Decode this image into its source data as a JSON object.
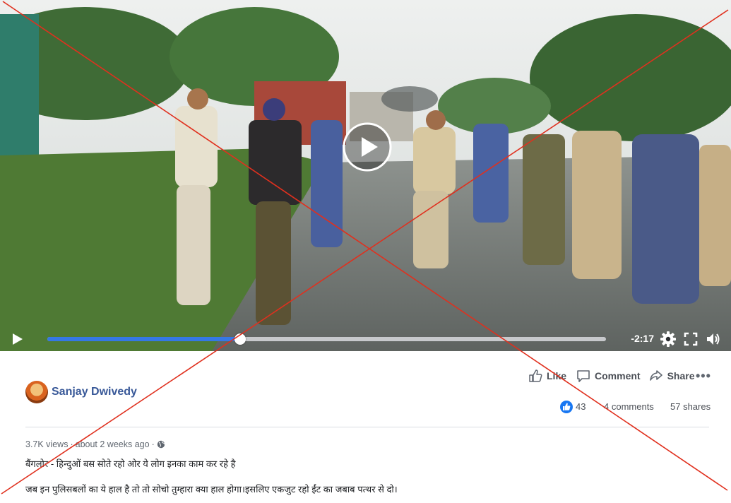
{
  "video": {
    "remaining_time": "-2:17",
    "progress": 0.345,
    "icons": [
      "play-icon",
      "settings-gear-icon",
      "fullscreen-icon",
      "volume-icon",
      "big-play-icon"
    ]
  },
  "post": {
    "author": "Sanjay Dwivedy",
    "actions": {
      "like": "Like",
      "comment": "Comment",
      "share": "Share",
      "more": "•••"
    },
    "stats": {
      "likes": "43",
      "comments": "4 comments",
      "shares": "57 shares"
    },
    "meta": {
      "views": "3.7K views",
      "separator": "·",
      "time": "about 2 weeks ago",
      "dot": "·"
    },
    "text_line1": "बैंगलोर - हिन्दुओं बस सोते रहो ओर ये लोग इनका काम कर रहे है",
    "text_line2": "जब इन पुलिसबलों का ये हाल है तो तो सोचो तुम्हारा क्या हाल होगा।इसलिए एकजुट रहो ईंट का जबाब पत्थर से दो।"
  },
  "colors": {
    "accent": "#3578e5",
    "author_link": "#385898",
    "cross": "#e0301e",
    "like_blue": "#1877f2"
  }
}
